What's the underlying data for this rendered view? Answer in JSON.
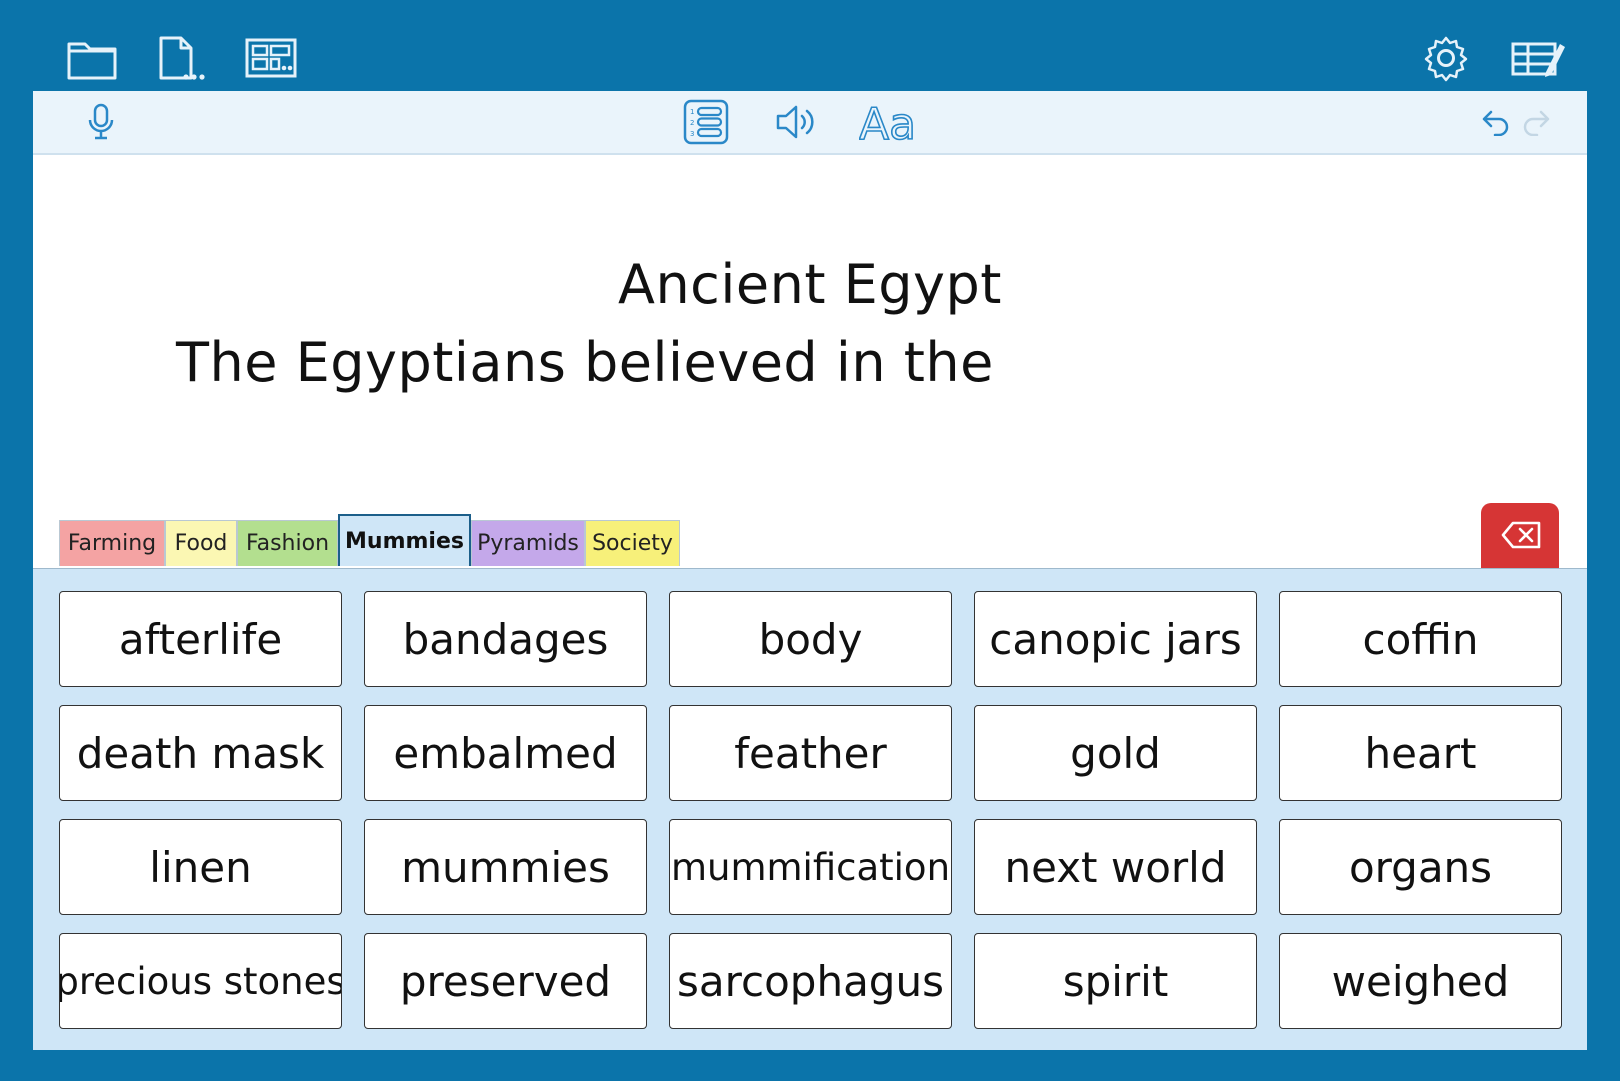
{
  "colors": {
    "frame_blue": "#0b74aa",
    "icon_blue": "#2a88c8",
    "panel_blue": "#cfe6f7",
    "delete_red": "#d63535",
    "tab_farming": "#f4a3a3",
    "tab_food": "#fbf7b3",
    "tab_fashion": "#b3df8f",
    "tab_mummies": "#cfe6f7",
    "tab_pyramids": "#c4a8ea",
    "tab_society": "#f7f07a"
  },
  "topbar": {
    "icons": [
      "folder-icon",
      "new-document-icon",
      "grid-set-icon",
      "settings-gear-icon",
      "edit-grid-icon"
    ]
  },
  "toolbar": {
    "icons": [
      "microphone-icon",
      "numbered-list-icon",
      "speaker-icon",
      "font-size-icon",
      "undo-icon",
      "redo-icon"
    ],
    "font_button_label": "Aa"
  },
  "document": {
    "title": "Ancient Egypt",
    "text": "The Egyptians believed in the"
  },
  "tabs": [
    {
      "label": "Farming",
      "color": "#f4a3a3",
      "active": false
    },
    {
      "label": "Food",
      "color": "#fbf7b3",
      "active": false
    },
    {
      "label": "Fashion",
      "color": "#b3df8f",
      "active": false
    },
    {
      "label": "Mummies",
      "color": "#cfe6f7",
      "active": true
    },
    {
      "label": "Pyramids",
      "color": "#c4a8ea",
      "active": false
    },
    {
      "label": "Society",
      "color": "#f7f07a",
      "active": false
    }
  ],
  "delete_button": {
    "icon": "backspace-icon"
  },
  "words": [
    "afterlife",
    "bandages",
    "body",
    "canopic jars",
    "coffin",
    "death mask",
    "embalmed",
    "feather",
    "gold",
    "heart",
    "linen",
    "mummies",
    "mummification",
    "next world",
    "organs",
    "precious stones",
    "preserved",
    "sarcophagus",
    "spirit",
    "weighed"
  ]
}
